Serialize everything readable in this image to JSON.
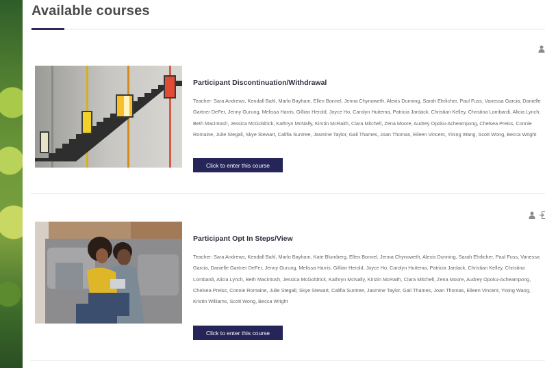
{
  "page": {
    "title": "Available courses"
  },
  "courses": [
    {
      "title": "Participant Discontinuation/Withdrawal",
      "teacher_text": "Teacher: Sara Andrews, Kendall Bahl, Marlo Bayham, Ellen Bonnel, Jenna Chynoweth, Alexis Dunning, Sarah Ehrlicher, Paul Fuss, Vanessa Garcia, Danielle Gartner DeFer, Jenny Gurung, Melissa Harris, Gillian Herold, Joyce Ho, Carolyn Huitema, Patricia Jardack, Christian Kelley, Christina Lombardi, Alicia Lynch, Beth Macintosh, Jessica McGoldrick, Kathryn McNally, Kirstin McRaith, Ciara Mitchell, Zena Moore, Audrey Opoku-Acheampong, Chelsea Preiss, Connie Romaine, Julie Stegall, Skye Stewart, Califia Suntree, Jasmine Taylor, Gail Thames, Joan Thomas, Eileen Vincent, Yining Wang, Scott Wong, Becca Wright",
      "button_label": "Click to enter this course",
      "image_icon": "staircase-lamps-image",
      "meta_icons": [
        "person-icon"
      ]
    },
    {
      "title": "Participant Opt In Steps/View",
      "teacher_text": "Teacher: Sara Andrews, Kendall Bahl, Marlo Bayham, Kate Blumberg, Ellen Bonnel, Jenna Chynoweth, Alexis Dunning, Sarah Ehrlicher, Paul Fuss, Vanessa Garcia, Danielle Gartner DeFer, Jenny Gurung, Melissa Harris, Gillian Herold, Joyce Ho, Carolyn Huitema, Patricia Jardack, Christian Kelley, Christina Lombardi, Alicia Lynch, Beth Macintosh, Jessica McGoldrick, Kathryn McNally, Kirstin McRaith, Ciara Mitchell, Zena Moore, Audrey Opoku-Acheampong, Chelsea Preiss, Connie Romaine, Julie Stegall, Skye Stewart, Califia Suntree, Jasmine Taylor, Gail Thames, Joan Thomas, Eileen Vincent, Yining Wang, Kristin Williams, Scott Wong, Becca Wright",
      "button_label": "Click to enter this course",
      "image_icon": "couple-on-couch-image",
      "meta_icons": [
        "person-icon",
        "login-icon"
      ]
    }
  ],
  "colors": {
    "button_bg": "#25255a",
    "title_underline": "#2c2a5a",
    "heading": "#4a4a4a"
  }
}
